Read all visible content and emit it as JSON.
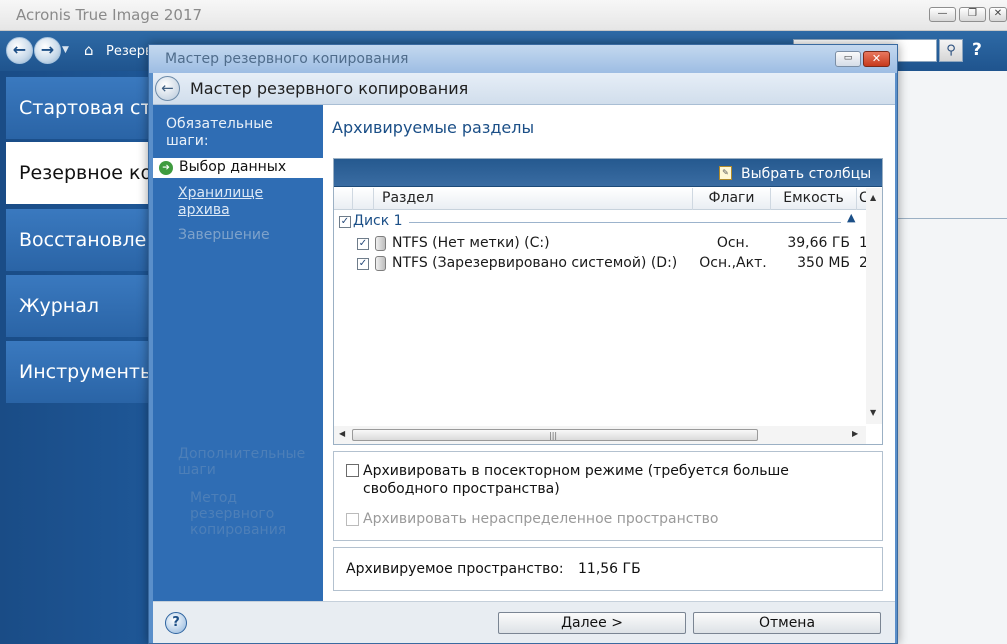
{
  "app": {
    "title": "Acronis True Image 2017",
    "window_buttons": [
      "—",
      "❐",
      "✕"
    ],
    "breadcrumb": "Резерв",
    "help_label": "?",
    "sidebar": {
      "items": [
        {
          "label": "Стартовая страница"
        },
        {
          "label": "Резервное копирование"
        },
        {
          "label": "Восстановление"
        },
        {
          "label": "Журнал"
        },
        {
          "label": "Инструменты и утилиты"
        }
      ]
    }
  },
  "wizard": {
    "window_title": "Мастер резервного копирования",
    "header_title": "Мастер резервного копирования",
    "steps": {
      "required_heading": "Обязательные шаги:",
      "current": "Выбор данных",
      "storage": "Хранилище архива",
      "finish": "Завершение",
      "optional_heading": "Дополнительные шаги",
      "method": "Метод резервного копирования"
    },
    "content": {
      "title": "Архивируемые разделы",
      "select_columns": "Выбрать столбцы",
      "columns": [
        "Раздел",
        "Флаги",
        "Емкость",
        "С"
      ],
      "disk": {
        "label": "Диск 1",
        "checked": true
      },
      "partitions": [
        {
          "name": "NTFS (Нет метки) (C:)",
          "flags": "Осн.",
          "size": "39,66 ГБ",
          "extra": "1",
          "checked": true
        },
        {
          "name": "NTFS (Зарезервировано системой) (D:)",
          "flags": "Осн.,Акт.",
          "size": "350 МБ",
          "extra": "2",
          "checked": true
        }
      ],
      "options": {
        "sector_mode": {
          "label": "Архивировать в посекторном режиме (требуется больше свободного пространства)",
          "checked": false,
          "enabled": true
        },
        "unallocated": {
          "label": "Архивировать нераспределенное пространство",
          "checked": false,
          "enabled": false
        }
      },
      "space": {
        "label": "Архивируемое пространство:",
        "value": "11,56 ГБ"
      }
    },
    "footer": {
      "help": "?",
      "next": "Далее >",
      "cancel": "Отмена"
    }
  }
}
